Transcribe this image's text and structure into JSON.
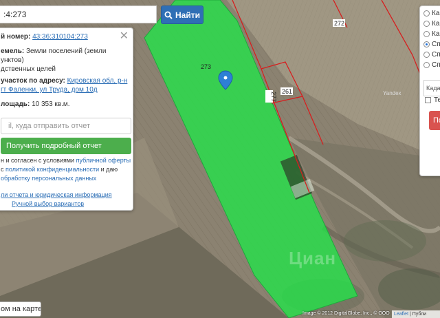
{
  "search": {
    "query": ":4:273",
    "button_label": "Найти"
  },
  "info_panel": {
    "cadastral_label": "й номер:",
    "cadastral_number": "43:36:310104:273",
    "land_category_label": "емель:",
    "land_category_line1": "Земли поселений (земли",
    "land_category_line2": "унктов)",
    "land_category_line3": "дственных целей",
    "address_label": "участок по адресу:",
    "address_line1": "Кировская обл, р-н",
    "address_line2": "гт Фаленки, ул Труда, дом 10д",
    "area_label": "лощадь:",
    "area_value": "10 353 кв.м.",
    "email_placeholder": "il, куда отправить отчет",
    "report_button": "Получить подробный отчет",
    "agree_line1_text": "н и согласен с условиями",
    "agree_line1_link": "публичной оферты",
    "agree_line2_text": "с",
    "agree_line2_link": "политикой конфиденциальности",
    "agree_line2_tail": "и даю",
    "agree_line3": "обработку персональных данных",
    "legal_link": "ли отчета и юридическая информация",
    "manual_link": "Ручной выбор вариантов"
  },
  "right_panel": {
    "options": [
      {
        "label": "Ка",
        "checked": false
      },
      {
        "label": "Ка",
        "checked": false
      },
      {
        "label": "Ка",
        "checked": false
      },
      {
        "label": "Сп",
        "checked": true
      },
      {
        "label": "Сп",
        "checked": false
      },
      {
        "label": "Сп",
        "checked": false
      }
    ],
    "input_value": "Кадас",
    "checkbox_label": "Те",
    "button_label": "По"
  },
  "map": {
    "parcel_label_main": "273",
    "parcel_label_272": "272",
    "parcel_label_261": "261",
    "parcel_label_277": "277",
    "yandex_label": "Yandex",
    "watermark": "Циан",
    "highlight_color": "#21e548",
    "boundary_color": "#d61f1f"
  },
  "bottom_question": "ом на карте?",
  "copyright": "Image © 2012 DigitalGlobe, Inc., © OOO",
  "attribution_leaflet": "Leaflet",
  "attribution_tail": "| Публи"
}
